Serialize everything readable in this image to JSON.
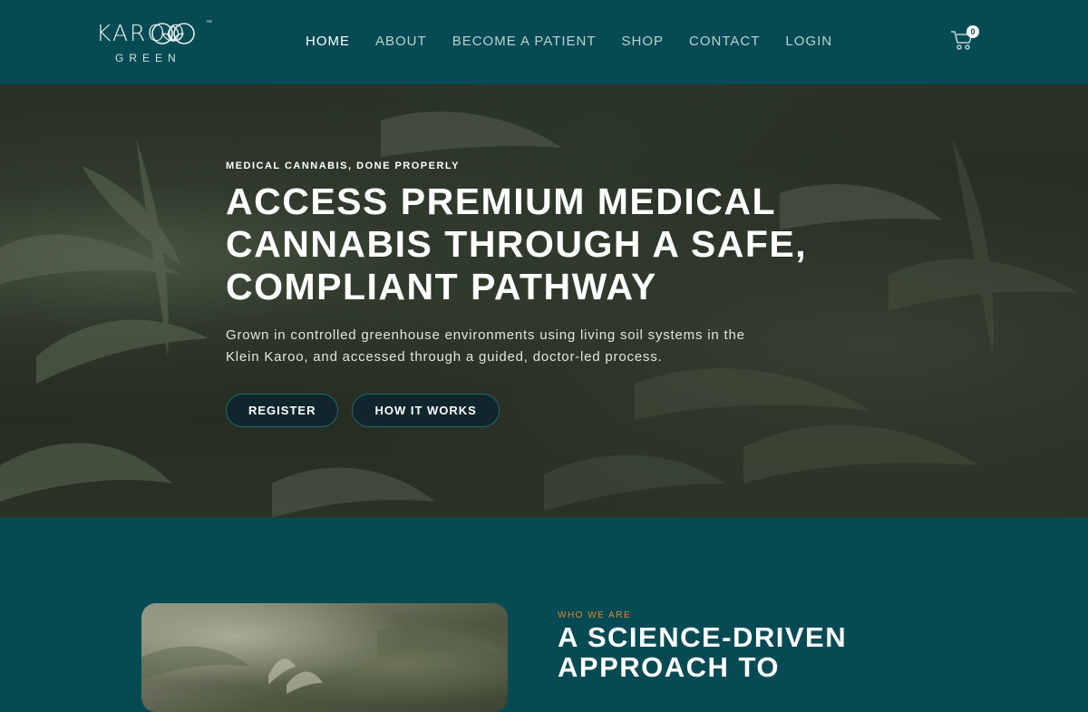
{
  "brand": {
    "name": "KAROO",
    "sub": "GREEN",
    "tm": "™"
  },
  "nav": {
    "items": [
      {
        "label": "HOME",
        "active": true
      },
      {
        "label": "ABOUT",
        "active": false
      },
      {
        "label": "BECOME A PATIENT",
        "active": false
      },
      {
        "label": "SHOP",
        "active": false
      },
      {
        "label": "CONTACT",
        "active": false
      },
      {
        "label": "LOGIN",
        "active": false
      }
    ],
    "cart_count": "0"
  },
  "hero": {
    "eyebrow": "MEDICAL CANNABIS, DONE PROPERLY",
    "title": "ACCESS PREMIUM MEDICAL CANNABIS THROUGH A SAFE, COMPLIANT PATHWAY",
    "description": "Grown in controlled greenhouse environments using living soil systems in the Klein Karoo, and accessed through a guided, doctor-led process.",
    "buttons": {
      "register": "REGISTER",
      "how_it_works": "HOW IT WORKS"
    }
  },
  "about": {
    "kicker": "WHO WE ARE",
    "title": "A SCIENCE-DRIVEN APPROACH TO"
  },
  "colors": {
    "primary": "#064a54",
    "accent": "#e0872c",
    "button_bg": "#10252c",
    "accessibility": "#2b54e0"
  },
  "icons": {
    "cart": "cart-icon",
    "accessibility": "accessibility-icon",
    "logo_mark": "leaf-mark-icon"
  }
}
